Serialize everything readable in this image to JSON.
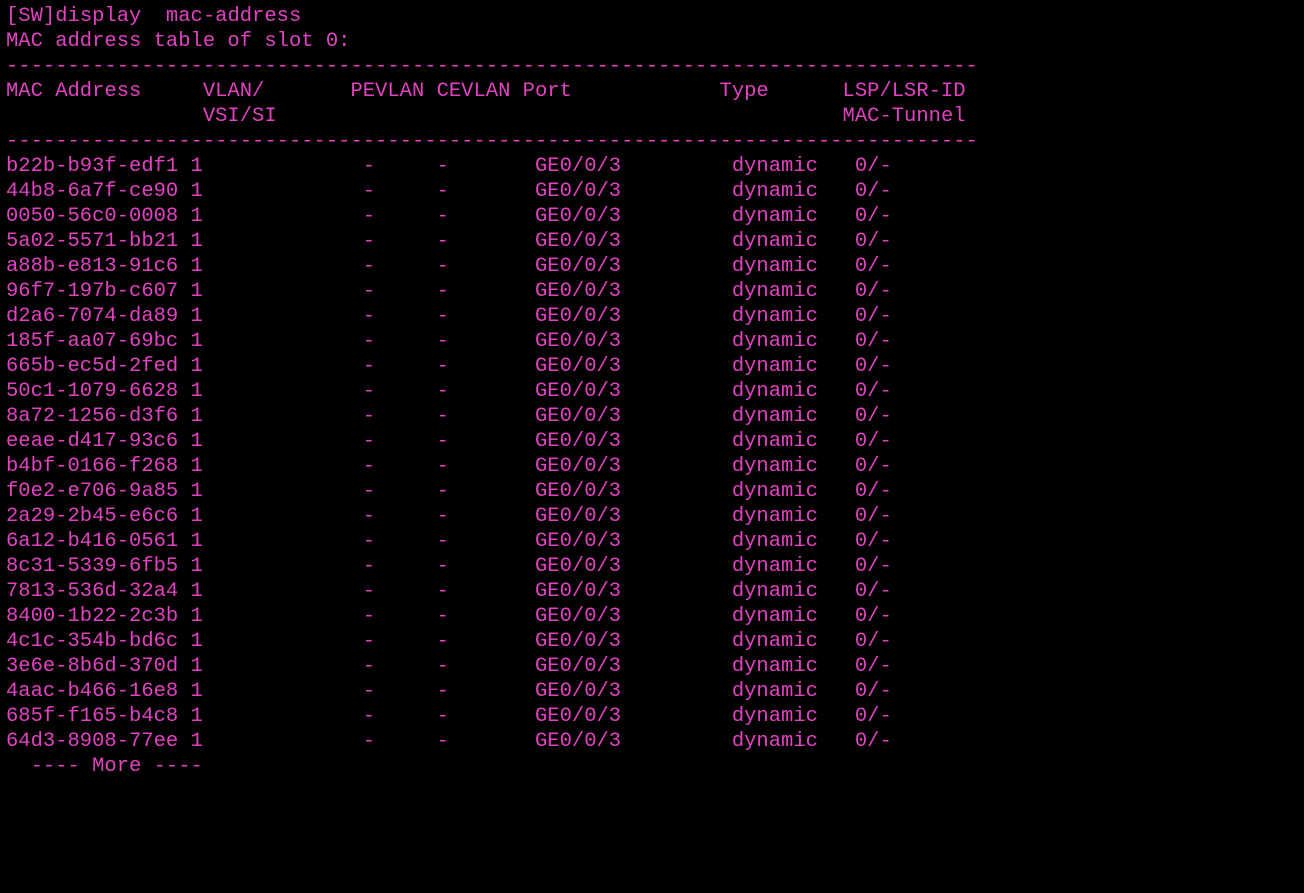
{
  "terminal": {
    "prompt_prefix": "[SW]",
    "command": "display  mac-address",
    "subtitle": "MAC address table of slot 0:",
    "separator": "-------------------------------------------------------------------------------",
    "header_line1": "MAC Address     VLAN/       PEVLAN CEVLAN Port            Type      LSP/LSR-ID",
    "header_line2": "                VSI/SI                                              MAC-Tunnel",
    "more_prompt": "  ---- More ----",
    "columns": [
      "MAC Address",
      "VLAN/VSI/SI",
      "PEVLAN",
      "CEVLAN",
      "Port",
      "Type",
      "LSP/LSR-ID MAC-Tunnel"
    ],
    "rows": [
      {
        "mac": "b22b-b93f-edf1",
        "vlan": "1",
        "pevlan": "-",
        "cevlan": "-",
        "port": "GE0/0/3",
        "type": "dynamic",
        "lsp": "0/-"
      },
      {
        "mac": "44b8-6a7f-ce90",
        "vlan": "1",
        "pevlan": "-",
        "cevlan": "-",
        "port": "GE0/0/3",
        "type": "dynamic",
        "lsp": "0/-"
      },
      {
        "mac": "0050-56c0-0008",
        "vlan": "1",
        "pevlan": "-",
        "cevlan": "-",
        "port": "GE0/0/3",
        "type": "dynamic",
        "lsp": "0/-"
      },
      {
        "mac": "5a02-5571-bb21",
        "vlan": "1",
        "pevlan": "-",
        "cevlan": "-",
        "port": "GE0/0/3",
        "type": "dynamic",
        "lsp": "0/-"
      },
      {
        "mac": "a88b-e813-91c6",
        "vlan": "1",
        "pevlan": "-",
        "cevlan": "-",
        "port": "GE0/0/3",
        "type": "dynamic",
        "lsp": "0/-"
      },
      {
        "mac": "96f7-197b-c607",
        "vlan": "1",
        "pevlan": "-",
        "cevlan": "-",
        "port": "GE0/0/3",
        "type": "dynamic",
        "lsp": "0/-"
      },
      {
        "mac": "d2a6-7074-da89",
        "vlan": "1",
        "pevlan": "-",
        "cevlan": "-",
        "port": "GE0/0/3",
        "type": "dynamic",
        "lsp": "0/-"
      },
      {
        "mac": "185f-aa07-69bc",
        "vlan": "1",
        "pevlan": "-",
        "cevlan": "-",
        "port": "GE0/0/3",
        "type": "dynamic",
        "lsp": "0/-"
      },
      {
        "mac": "665b-ec5d-2fed",
        "vlan": "1",
        "pevlan": "-",
        "cevlan": "-",
        "port": "GE0/0/3",
        "type": "dynamic",
        "lsp": "0/-"
      },
      {
        "mac": "50c1-1079-6628",
        "vlan": "1",
        "pevlan": "-",
        "cevlan": "-",
        "port": "GE0/0/3",
        "type": "dynamic",
        "lsp": "0/-"
      },
      {
        "mac": "8a72-1256-d3f6",
        "vlan": "1",
        "pevlan": "-",
        "cevlan": "-",
        "port": "GE0/0/3",
        "type": "dynamic",
        "lsp": "0/-"
      },
      {
        "mac": "eeae-d417-93c6",
        "vlan": "1",
        "pevlan": "-",
        "cevlan": "-",
        "port": "GE0/0/3",
        "type": "dynamic",
        "lsp": "0/-"
      },
      {
        "mac": "b4bf-0166-f268",
        "vlan": "1",
        "pevlan": "-",
        "cevlan": "-",
        "port": "GE0/0/3",
        "type": "dynamic",
        "lsp": "0/-"
      },
      {
        "mac": "f0e2-e706-9a85",
        "vlan": "1",
        "pevlan": "-",
        "cevlan": "-",
        "port": "GE0/0/3",
        "type": "dynamic",
        "lsp": "0/-"
      },
      {
        "mac": "2a29-2b45-e6c6",
        "vlan": "1",
        "pevlan": "-",
        "cevlan": "-",
        "port": "GE0/0/3",
        "type": "dynamic",
        "lsp": "0/-"
      },
      {
        "mac": "6a12-b416-0561",
        "vlan": "1",
        "pevlan": "-",
        "cevlan": "-",
        "port": "GE0/0/3",
        "type": "dynamic",
        "lsp": "0/-"
      },
      {
        "mac": "8c31-5339-6fb5",
        "vlan": "1",
        "pevlan": "-",
        "cevlan": "-",
        "port": "GE0/0/3",
        "type": "dynamic",
        "lsp": "0/-"
      },
      {
        "mac": "7813-536d-32a4",
        "vlan": "1",
        "pevlan": "-",
        "cevlan": "-",
        "port": "GE0/0/3",
        "type": "dynamic",
        "lsp": "0/-"
      },
      {
        "mac": "8400-1b22-2c3b",
        "vlan": "1",
        "pevlan": "-",
        "cevlan": "-",
        "port": "GE0/0/3",
        "type": "dynamic",
        "lsp": "0/-"
      },
      {
        "mac": "4c1c-354b-bd6c",
        "vlan": "1",
        "pevlan": "-",
        "cevlan": "-",
        "port": "GE0/0/3",
        "type": "dynamic",
        "lsp": "0/-"
      },
      {
        "mac": "3e6e-8b6d-370d",
        "vlan": "1",
        "pevlan": "-",
        "cevlan": "-",
        "port": "GE0/0/3",
        "type": "dynamic",
        "lsp": "0/-"
      },
      {
        "mac": "4aac-b466-16e8",
        "vlan": "1",
        "pevlan": "-",
        "cevlan": "-",
        "port": "GE0/0/3",
        "type": "dynamic",
        "lsp": "0/-"
      },
      {
        "mac": "685f-f165-b4c8",
        "vlan": "1",
        "pevlan": "-",
        "cevlan": "-",
        "port": "GE0/0/3",
        "type": "dynamic",
        "lsp": "0/-"
      },
      {
        "mac": "64d3-8908-77ee",
        "vlan": "1",
        "pevlan": "-",
        "cevlan": "-",
        "port": "GE0/0/3",
        "type": "dynamic",
        "lsp": "0/-"
      }
    ]
  }
}
